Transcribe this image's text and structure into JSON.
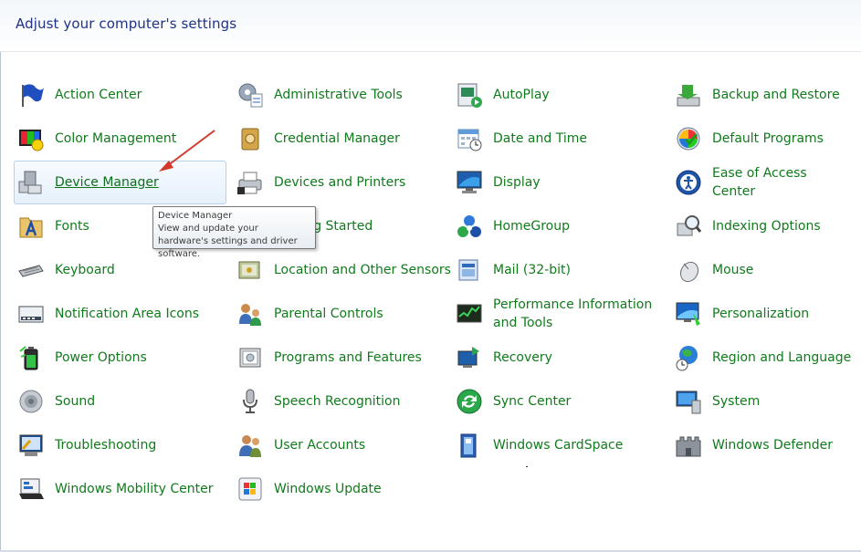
{
  "header": {
    "title": "Adjust your computer's settings"
  },
  "items": [
    {
      "label": "Action Center",
      "icon": "flag-icon"
    },
    {
      "label": "Administrative Tools",
      "icon": "admin-tools-icon"
    },
    {
      "label": "AutoPlay",
      "icon": "autoplay-icon"
    },
    {
      "label": "Backup and Restore",
      "icon": "backup-restore-icon"
    },
    {
      "label": "Color Management",
      "icon": "color-management-icon"
    },
    {
      "label": "Credential Manager",
      "icon": "credential-vault-icon"
    },
    {
      "label": "Date and Time",
      "icon": "calendar-clock-icon"
    },
    {
      "label": "Default Programs",
      "icon": "default-programs-icon"
    },
    {
      "label": "Device Manager",
      "icon": "device-manager-icon"
    },
    {
      "label": "Devices and Printers",
      "icon": "printer-icon"
    },
    {
      "label": "Display",
      "icon": "monitor-icon"
    },
    {
      "label": "Ease of Access Center",
      "icon": "ease-of-access-icon"
    },
    {
      "label": "Fonts",
      "icon": "fonts-folder-icon"
    },
    {
      "label": "Getting Started",
      "icon": "getting-started-icon"
    },
    {
      "label": "HomeGroup",
      "icon": "homegroup-icon"
    },
    {
      "label": "Indexing Options",
      "icon": "indexing-magnifier-icon"
    },
    {
      "label": "Keyboard",
      "icon": "keyboard-icon"
    },
    {
      "label": "Location and Other Sensors",
      "icon": "location-sensors-icon"
    },
    {
      "label": "Mail (32-bit)",
      "icon": "mail-icon"
    },
    {
      "label": "Mouse",
      "icon": "mouse-icon"
    },
    {
      "label": "Notification Area Icons",
      "icon": "notification-area-icon"
    },
    {
      "label": "Parental Controls",
      "icon": "parental-controls-icon"
    },
    {
      "label": "Performance Information and Tools",
      "icon": "performance-icon"
    },
    {
      "label": "Personalization",
      "icon": "personalization-icon"
    },
    {
      "label": "Power Options",
      "icon": "battery-icon"
    },
    {
      "label": "Programs and Features",
      "icon": "programs-features-icon"
    },
    {
      "label": "Recovery",
      "icon": "recovery-icon"
    },
    {
      "label": "Region and Language",
      "icon": "globe-clock-icon"
    },
    {
      "label": "Sound",
      "icon": "speaker-icon"
    },
    {
      "label": "Speech Recognition",
      "icon": "microphone-icon"
    },
    {
      "label": "Sync Center",
      "icon": "sync-icon"
    },
    {
      "label": "System",
      "icon": "system-icon"
    },
    {
      "label": "Troubleshooting",
      "icon": "troubleshooting-icon"
    },
    {
      "label": "User Accounts",
      "icon": "users-icon"
    },
    {
      "label": "Windows CardSpace",
      "icon": "cardspace-icon"
    },
    {
      "label": "Windows Defender",
      "icon": "defender-castle-icon"
    },
    {
      "label": "Windows Mobility Center",
      "icon": "mobility-center-icon"
    },
    {
      "label": "Windows Update",
      "icon": "windows-update-icon"
    }
  ],
  "hovered_item": "Device Manager",
  "tooltip": {
    "title": "Device Manager",
    "description": "View and update your hardware's settings and driver software."
  },
  "colors": {
    "link": "#117a1c",
    "header_text": "#1e3287",
    "hover_border": "#b7d2ea",
    "annotation_arrow": "#d23a2c"
  }
}
